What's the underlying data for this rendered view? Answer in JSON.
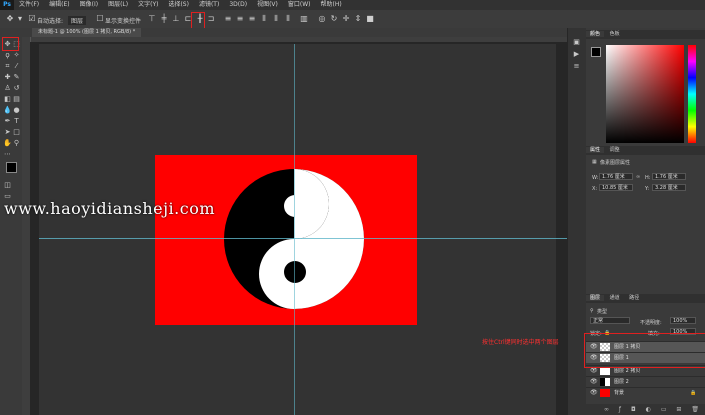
{
  "menu": {
    "logo": "Ps",
    "items": [
      "文件(F)",
      "编辑(E)",
      "图像(I)",
      "图层(L)",
      "文字(Y)",
      "选择(S)",
      "滤镜(T)",
      "3D(D)",
      "视图(V)",
      "窗口(W)",
      "帮助(H)"
    ]
  },
  "options": {
    "auto_select_label": "自动选择:",
    "auto_select_value": "图层",
    "transform_label": "显示变换控件"
  },
  "document_tab": {
    "label": "未标题-1 @ 100% (图层 1 拷贝, RGB/8) *"
  },
  "watermark": "www.haoyidiansheji.com",
  "panels": {
    "color_tabs": [
      "颜色",
      "色板"
    ],
    "properties_tabs": [
      "属性",
      "调整"
    ],
    "properties_title": "像素图层属性",
    "w_label": "W:",
    "w_value": "1.76 厘米",
    "h_label": "H:",
    "h_value": "1.76 厘米",
    "x_label": "X:",
    "x_value": "10.85 厘米",
    "y_label": "Y:",
    "y_value": "3.28 厘米",
    "layers_tabs": [
      "图层",
      "通道",
      "路径"
    ],
    "kind_label": "类型",
    "blend_mode": "正常",
    "opacity_label": "不透明度:",
    "opacity_value": "100%",
    "lock_label": "锁定:",
    "fill_label": "填充:",
    "fill_value": "100%",
    "layers": [
      {
        "name": "图层 1 拷贝",
        "selected": true
      },
      {
        "name": "图层 1",
        "selected": true
      },
      {
        "name": "图层 2 拷贝",
        "selected": false
      },
      {
        "name": "图层 2",
        "selected": false
      },
      {
        "name": "背景",
        "selected": false
      }
    ]
  },
  "annotation": "按住Ctrl键同时选中两个图层",
  "colors": {
    "highlight": "#e02020",
    "canvas_red": "#ff0000",
    "guide": "#5fb7c9"
  }
}
